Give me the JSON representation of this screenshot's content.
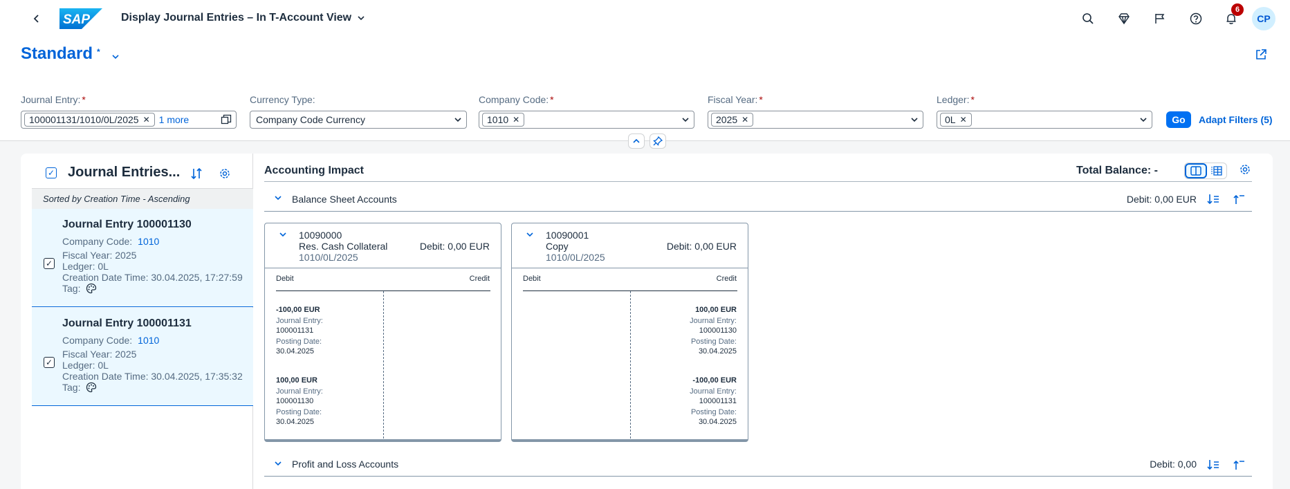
{
  "shell": {
    "title": "Display Journal Entries – In T-Account View",
    "notification_count": "6",
    "avatar_initials": "CP"
  },
  "header": {
    "variant": "Standard",
    "variant_modified": "*"
  },
  "filters": {
    "journal_entry": {
      "label": "Journal Entry:",
      "token": "100001131/1010/0L/2025",
      "more": "1 more"
    },
    "currency_type": {
      "label": "Currency Type:",
      "value": "Company Code Currency"
    },
    "company_code": {
      "label": "Company Code:",
      "token": "1010"
    },
    "fiscal_year": {
      "label": "Fiscal Year:",
      "token": "2025"
    },
    "ledger": {
      "label": "Ledger:",
      "token": "0L"
    },
    "required_mark": "*",
    "go": "Go",
    "adapt": "Adapt Filters (5)"
  },
  "list": {
    "title": "Journal Entries...",
    "sort_info": "Sorted by Creation Time - Ascending",
    "items": [
      {
        "title": "Journal Entry 100001130",
        "company_label": "Company Code:",
        "company": "1010",
        "fiscal_year": "Fiscal Year: 2025",
        "ledger": "Ledger: 0L",
        "created": "Creation Date Time: 30.04.2025, 17:27:59",
        "tag": "Tag:"
      },
      {
        "title": "Journal Entry 100001131",
        "company_label": "Company Code:",
        "company": "1010",
        "fiscal_year": "Fiscal Year: 2025",
        "ledger": "Ledger: 0L",
        "created": "Creation Date Time: 30.04.2025, 17:35:32",
        "tag": "Tag:"
      }
    ]
  },
  "impact": {
    "title": "Accounting Impact",
    "total_balance": "Total Balance: -",
    "balance_sheet": {
      "title": "Balance Sheet Accounts",
      "debit": "Debit: 0,00 EUR"
    },
    "pl": {
      "title": "Profit and Loss Accounts",
      "debit": "Debit: 0,00"
    },
    "accounts": [
      {
        "number": "10090000",
        "name": "Res. Cash Collateral",
        "ref": "1010/0L/2025",
        "debit": "Debit: 0,00 EUR",
        "debit_header": "Debit",
        "credit_header": "Credit",
        "debit_items": [
          {
            "amount": "-100,00 EUR",
            "je_label": "Journal Entry:",
            "je": "100001131",
            "pd_label": "Posting Date:",
            "pd": "30.04.2025"
          },
          {
            "amount": "100,00 EUR",
            "je_label": "Journal Entry:",
            "je": "100001130",
            "pd_label": "Posting Date:",
            "pd": "30.04.2025"
          }
        ]
      },
      {
        "number": "10090001",
        "name": "Copy",
        "ref": "1010/0L/2025",
        "debit": "Debit: 0,00 EUR",
        "debit_header": "Debit",
        "credit_header": "Credit",
        "credit_items": [
          {
            "amount": "100,00 EUR",
            "je_label": "Journal Entry:",
            "je": "100001130",
            "pd_label": "Posting Date:",
            "pd": "30.04.2025"
          },
          {
            "amount": "-100,00 EUR",
            "je_label": "Journal Entry:",
            "je": "100001131",
            "pd_label": "Posting Date:",
            "pd": "30.04.2025"
          }
        ]
      }
    ]
  }
}
